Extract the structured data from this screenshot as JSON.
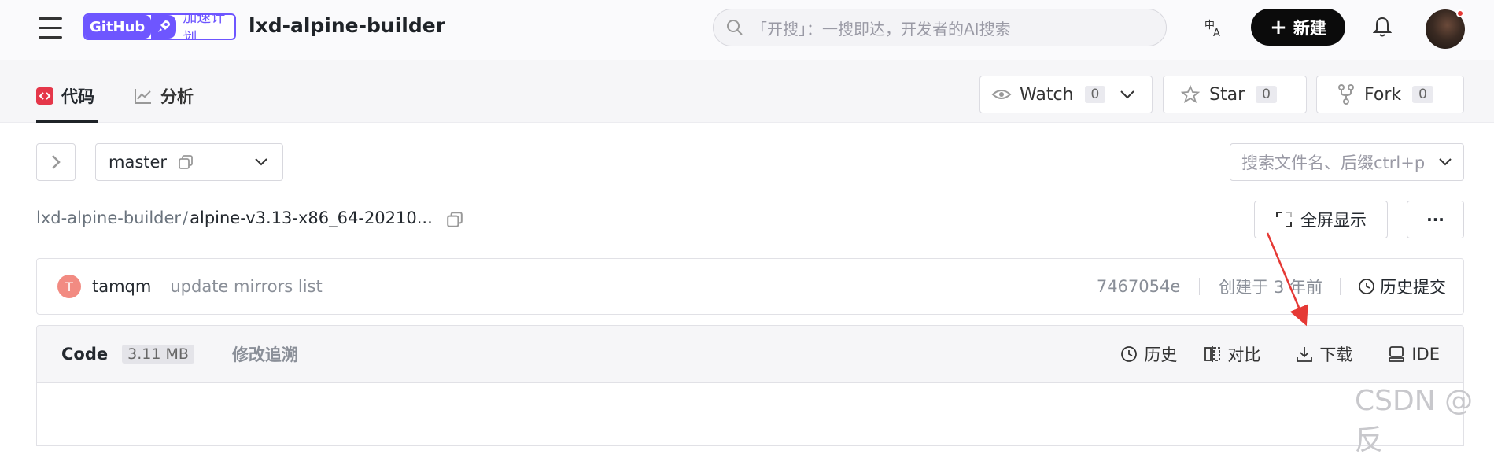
{
  "header": {
    "badge_left": "GitHub",
    "badge_right": "加速计划",
    "repo_title": "lxd-alpine-builder",
    "search_placeholder": "「开搜」：一搜即达，开发者的AI搜索",
    "new_button": "新建"
  },
  "tabs": [
    {
      "label": "代码"
    },
    {
      "label": "分析"
    }
  ],
  "repo_actions": {
    "watch": {
      "label": "Watch",
      "count": "0"
    },
    "star": {
      "label": "Star",
      "count": "0"
    },
    "fork": {
      "label": "Fork",
      "count": "0"
    }
  },
  "toolbar": {
    "branch": "master",
    "file_search_placeholder": "搜索文件名、后缀ctrl+p",
    "fullscreen": "全屏显示",
    "more": "···"
  },
  "breadcrumb": {
    "repo": "lxd-alpine-builder",
    "sep": "/",
    "file": "alpine-v3.13-x86_64-20210..."
  },
  "commit": {
    "avatar_letter": "T",
    "author": "tamqm",
    "message": "update mirrors list",
    "hash": "7467054e",
    "created": "创建于 3 年前",
    "history": "历史提交"
  },
  "code_header": {
    "code_label": "Code",
    "size": "3.11 MB",
    "blame": "修改追溯",
    "history": "历史",
    "compare": "对比",
    "download": "下载",
    "ide": "IDE"
  },
  "watermark": "CSDN @反",
  "colors": {
    "accent": "#6e56ff",
    "annotation_arrow": "#e53935",
    "code_tab_icon": "#e5374a"
  }
}
